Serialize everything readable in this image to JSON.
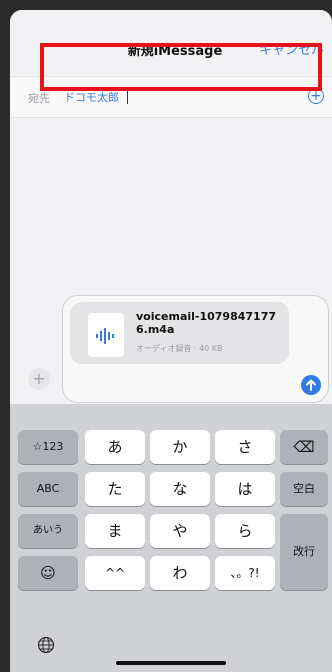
{
  "header": {
    "title": "新規iMessage",
    "cancel_label": "キャンセル"
  },
  "to_field": {
    "label": "宛先",
    "recipient": "ドコモ太郎"
  },
  "attachment": {
    "filename": "voicemail-10798471776.m4a",
    "meta": "オーディオ録音 · 40 KB"
  },
  "keyboard": {
    "rows": [
      [
        "☆123",
        "あ",
        "か",
        "さ",
        "⌫"
      ],
      [
        "ABC",
        "た",
        "な",
        "は",
        "空白"
      ],
      [
        "あいう",
        "ま",
        "や",
        "ら",
        "改行"
      ],
      [
        "☺",
        "^^",
        "わ",
        "、。?!"
      ]
    ]
  },
  "colors": {
    "accent": "#3b7bd8",
    "highlight": "#e8121c",
    "send": "#2f7ae6"
  }
}
